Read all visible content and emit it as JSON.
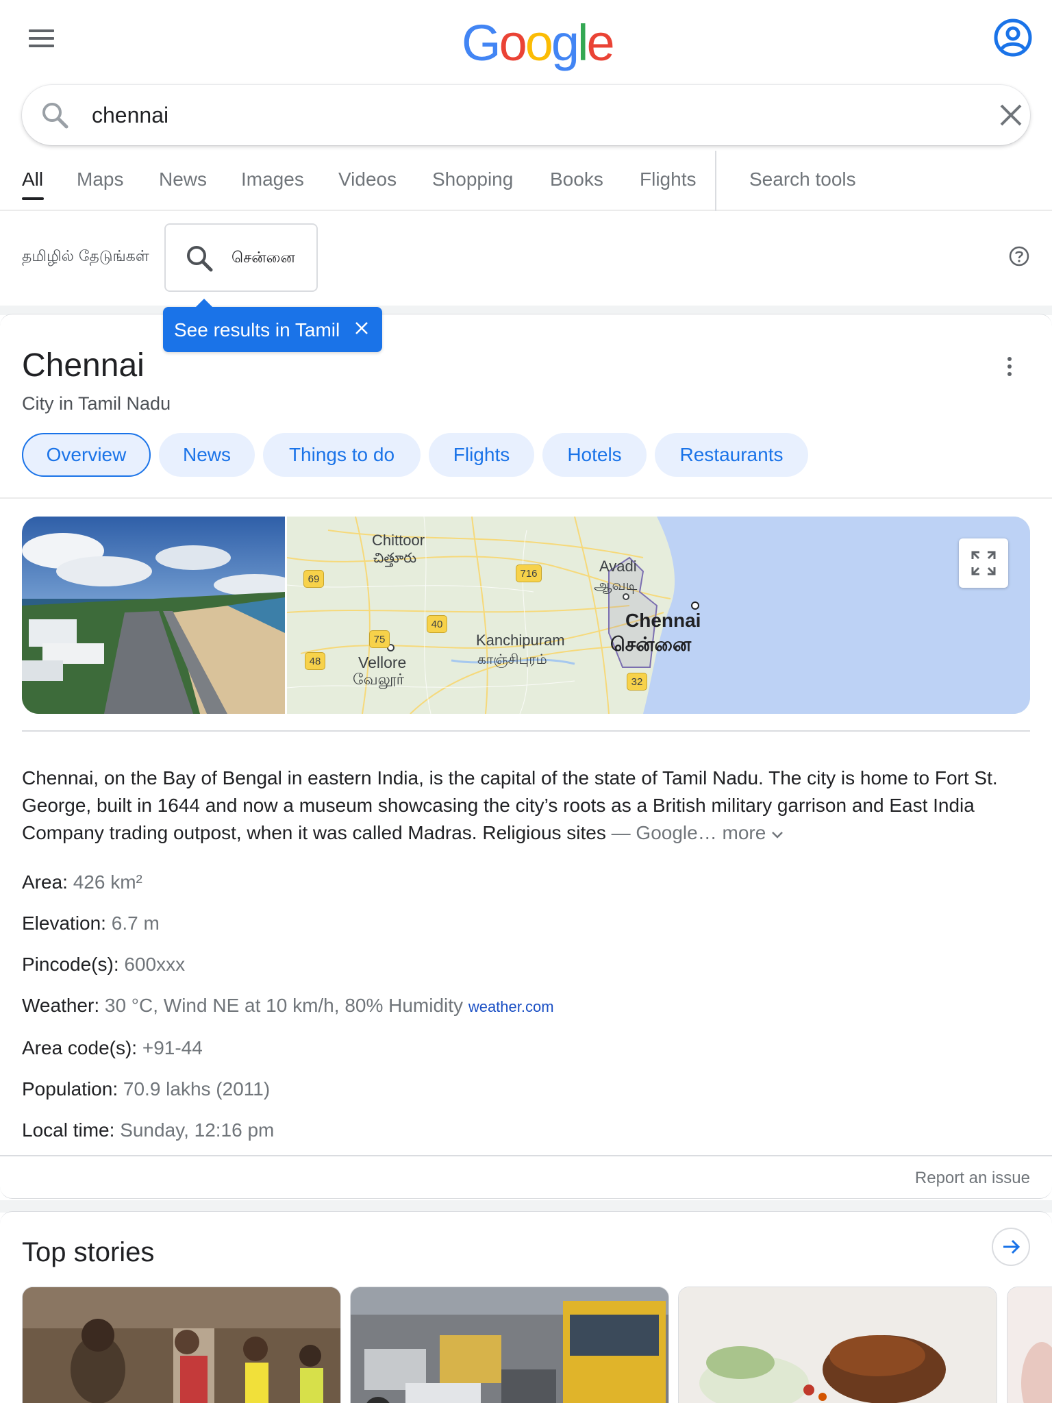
{
  "header": {
    "logo_letters": [
      "G",
      "o",
      "o",
      "g",
      "l",
      "e"
    ],
    "logo_colors": [
      "#4285f4",
      "#ea4335",
      "#fbbc05",
      "#4285f4",
      "#34a853",
      "#ea4335"
    ]
  },
  "search": {
    "value": "chennai",
    "placeholder": ""
  },
  "tabs": [
    {
      "label": "All",
      "active": true
    },
    {
      "label": "Maps"
    },
    {
      "label": "News"
    },
    {
      "label": "Images"
    },
    {
      "label": "Videos"
    },
    {
      "label": "Shopping"
    },
    {
      "label": "Books"
    },
    {
      "label": "Flights"
    },
    {
      "label": "Search tools"
    }
  ],
  "tamil": {
    "label": "தமிழில் தேடுங்கள்",
    "query": "சென்னை",
    "tooltip": "See results in Tamil"
  },
  "kp": {
    "title": "Chennai",
    "subtitle": "City in Tamil Nadu",
    "chips": [
      "Overview",
      "News",
      "Things to do",
      "Flights",
      "Hotels",
      "Restaurants"
    ],
    "map_labels": {
      "chittoor": "Chittoor",
      "chittoor_te": "చిత్తూరు",
      "avadi": "Avadi",
      "avadi_ta": "ஆவடி",
      "chennai": "Chennai",
      "chennai_ta": "சென்னை",
      "vellore": "Vellore",
      "vellore_ta": "வேலூர்",
      "kanchipuram": "Kanchipuram",
      "kanchipuram_ta": "காஞ்சிபுரம்",
      "routes": [
        "69",
        "716",
        "40",
        "75",
        "48",
        "32"
      ]
    },
    "description": "Chennai, on the Bay of Bengal in eastern India, is the capital of the state of Tamil Nadu. The city is home to Fort St. George, built in 1644 and now a museum showcasing the city’s roots as a British military garrison and East India Company trading outpost, when it was called Madras. Religious sites",
    "description_source": "— Google…",
    "more": "more",
    "facts": [
      {
        "label": "Area:",
        "value": "426 km²"
      },
      {
        "label": "Elevation:",
        "value": "6.7 m"
      },
      {
        "label": "Pincode(s):",
        "value": "600xxx"
      },
      {
        "label": "Weather:",
        "value": "30 °C, Wind NE at 10 km/h, 80% Humidity",
        "link": "weather.com"
      },
      {
        "label": "Area code(s):",
        "value": "+91-44"
      },
      {
        "label": "Population:",
        "value": "70.9 lakhs (2011)"
      },
      {
        "label": "Local time:",
        "value": "Sunday, 12:16 pm"
      }
    ],
    "report": "Report an issue"
  },
  "stories": {
    "title": "Top stories"
  },
  "colors": {
    "accent": "#1a73e8",
    "chip_bg": "#e8f0fe",
    "muted_text": "#70757a"
  }
}
